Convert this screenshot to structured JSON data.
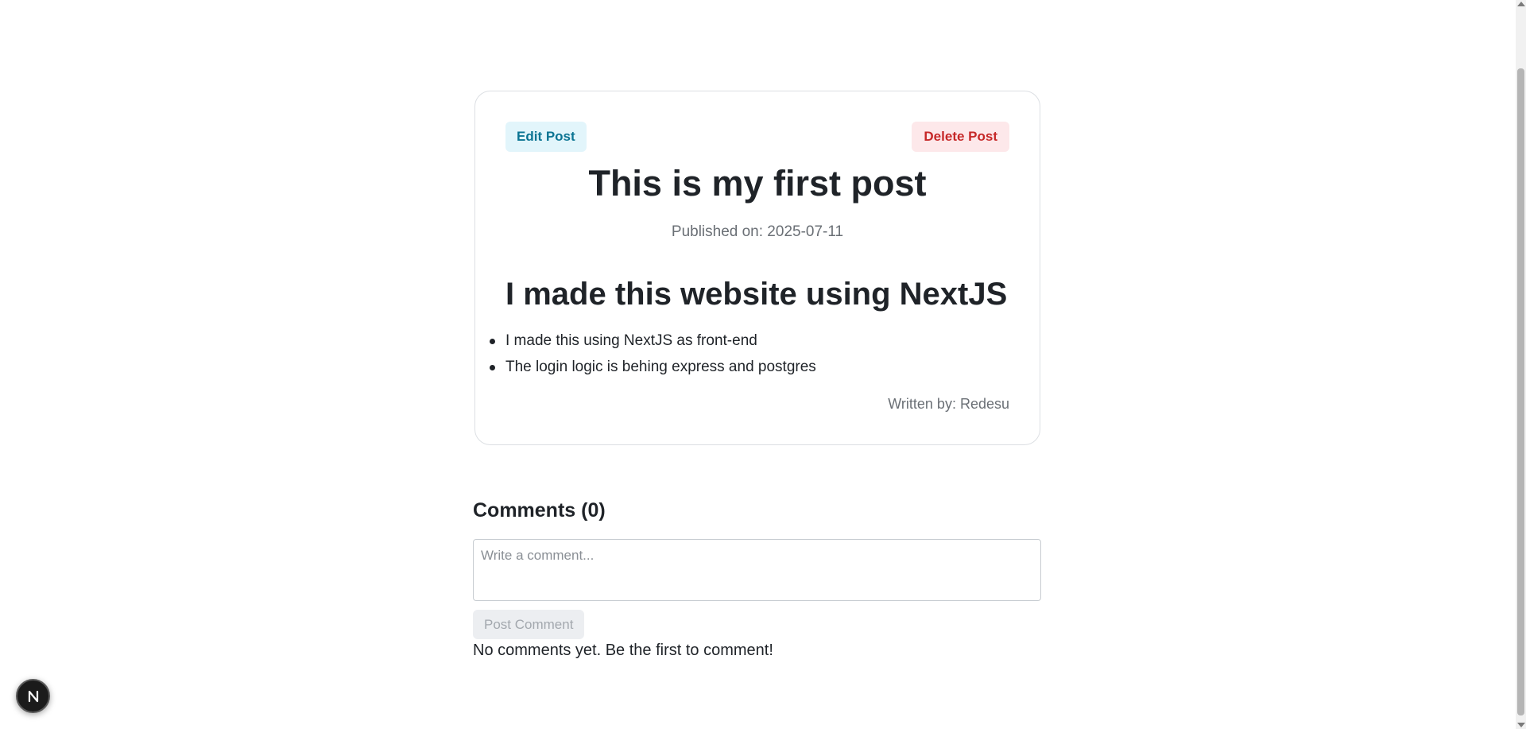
{
  "post": {
    "edit_label": "Edit Post",
    "delete_label": "Delete Post",
    "title": "This is my first post",
    "published": "Published on: 2025-07-11",
    "content": {
      "heading": "I made this website using NextJS",
      "items": [
        "I made this using NextJS as front-end",
        "The login logic is behing express and postgres"
      ]
    },
    "author": "Written by: Redesu"
  },
  "comments": {
    "heading": "Comments (0)",
    "input_placeholder": "Write a comment...",
    "input_value": "",
    "submit_label": "Post Comment",
    "empty_message": "No comments yet. Be the first to comment!"
  },
  "dev_badge": {
    "icon": "nextjs-logo-icon",
    "letter": "N"
  },
  "colors": {
    "edit_bg": "#e2f5fb",
    "edit_text": "#0b7493",
    "delete_bg": "#fde8ea",
    "delete_text": "#c62828",
    "disabled_bg": "#eceef1"
  }
}
